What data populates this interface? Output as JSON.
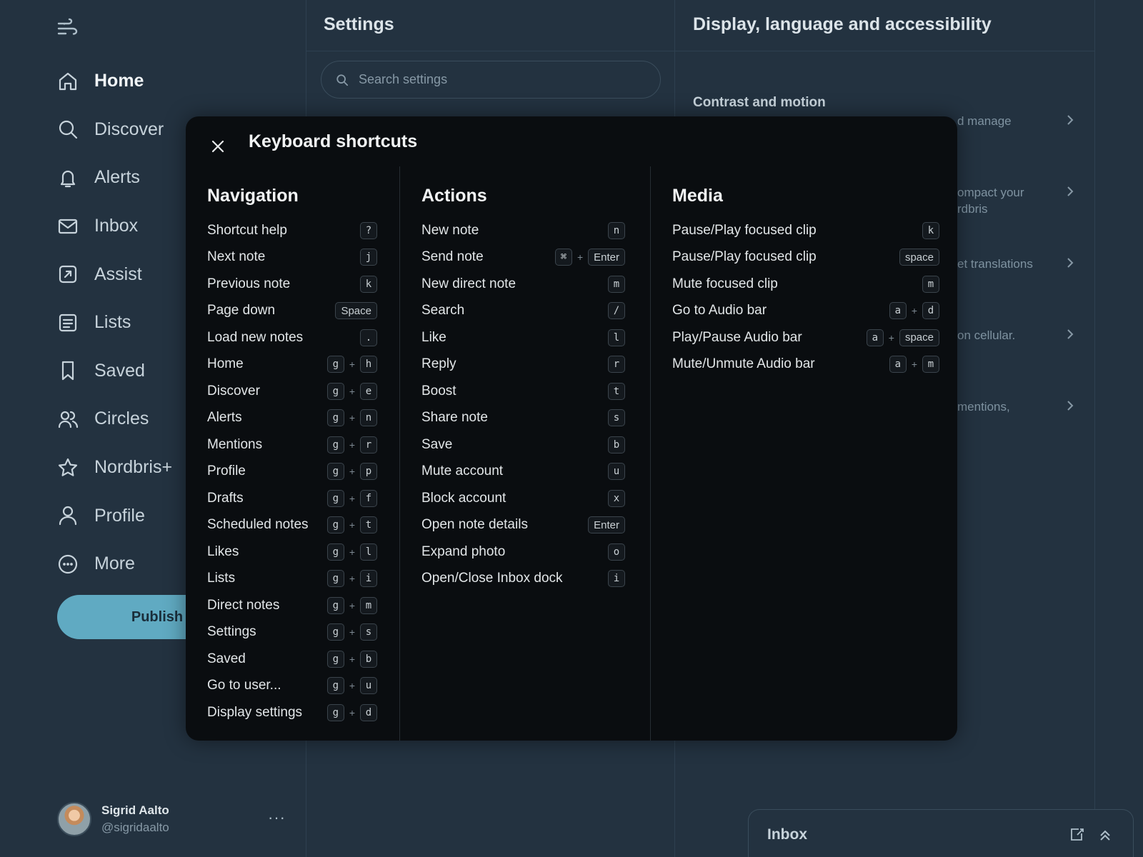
{
  "sidebar": {
    "nav": [
      {
        "label": "Home",
        "icon": "home-icon",
        "active": true
      },
      {
        "label": "Discover",
        "icon": "search-icon"
      },
      {
        "label": "Alerts",
        "icon": "bell-icon"
      },
      {
        "label": "Inbox",
        "icon": "mail-icon"
      },
      {
        "label": "Assist",
        "icon": "assist-icon"
      },
      {
        "label": "Lists",
        "icon": "list-icon"
      },
      {
        "label": "Saved",
        "icon": "bookmark-icon"
      },
      {
        "label": "Circles",
        "icon": "people-icon"
      },
      {
        "label": "Nordbris+",
        "icon": "star-icon"
      },
      {
        "label": "Profile",
        "icon": "user-icon"
      },
      {
        "label": "More",
        "icon": "more-circle-icon"
      }
    ],
    "publish_label": "Publish",
    "account": {
      "name": "Sigrid Aalto",
      "handle": "@sigridaalto",
      "more": "···"
    }
  },
  "settings": {
    "title": "Settings",
    "search_placeholder": "Search settings"
  },
  "display": {
    "title": "Display, language and accessibility",
    "section": "Contrast and motion",
    "snippets": [
      "d manage",
      "ompact your\nrdbris",
      "et translations",
      "on cellular.",
      "mentions,"
    ]
  },
  "inbox_dock": {
    "title": "Inbox"
  },
  "modal": {
    "title": "Keyboard shortcuts",
    "columns": [
      {
        "heading": "Navigation",
        "rows": [
          {
            "label": "Shortcut help",
            "keys": [
              "?"
            ]
          },
          {
            "label": "Next note",
            "keys": [
              "j"
            ]
          },
          {
            "label": "Previous note",
            "keys": [
              "k"
            ]
          },
          {
            "label": "Page down",
            "keys": [
              "Space"
            ]
          },
          {
            "label": "Load new notes",
            "keys": [
              "."
            ]
          },
          {
            "label": "Home",
            "keys": [
              "g",
              "h"
            ]
          },
          {
            "label": "Discover",
            "keys": [
              "g",
              "e"
            ]
          },
          {
            "label": "Alerts",
            "keys": [
              "g",
              "n"
            ]
          },
          {
            "label": "Mentions",
            "keys": [
              "g",
              "r"
            ]
          },
          {
            "label": "Profile",
            "keys": [
              "g",
              "p"
            ]
          },
          {
            "label": "Drafts",
            "keys": [
              "g",
              "f"
            ]
          },
          {
            "label": "Scheduled notes",
            "keys": [
              "g",
              "t"
            ]
          },
          {
            "label": "Likes",
            "keys": [
              "g",
              "l"
            ]
          },
          {
            "label": "Lists",
            "keys": [
              "g",
              "i"
            ]
          },
          {
            "label": "Direct notes",
            "keys": [
              "g",
              "m"
            ]
          },
          {
            "label": "Settings",
            "keys": [
              "g",
              "s"
            ]
          },
          {
            "label": "Saved",
            "keys": [
              "g",
              "b"
            ]
          },
          {
            "label": "Go to user...",
            "keys": [
              "g",
              "u"
            ]
          },
          {
            "label": "Display settings",
            "keys": [
              "g",
              "d"
            ]
          }
        ]
      },
      {
        "heading": "Actions",
        "rows": [
          {
            "label": "New note",
            "keys": [
              "n"
            ]
          },
          {
            "label": "Send note",
            "keys": [
              "⌘",
              "Enter"
            ]
          },
          {
            "label": "New direct note",
            "keys": [
              "m"
            ]
          },
          {
            "label": "Search",
            "keys": [
              "/"
            ]
          },
          {
            "label": "Like",
            "keys": [
              "l"
            ]
          },
          {
            "label": "Reply",
            "keys": [
              "r"
            ]
          },
          {
            "label": "Boost",
            "keys": [
              "t"
            ]
          },
          {
            "label": "Share note",
            "keys": [
              "s"
            ]
          },
          {
            "label": "Save",
            "keys": [
              "b"
            ]
          },
          {
            "label": "Mute account",
            "keys": [
              "u"
            ]
          },
          {
            "label": "Block account",
            "keys": [
              "x"
            ]
          },
          {
            "label": "Open note details",
            "keys": [
              "Enter"
            ]
          },
          {
            "label": "Expand photo",
            "keys": [
              "o"
            ]
          },
          {
            "label": "Open/Close Inbox dock",
            "keys": [
              "i"
            ]
          }
        ]
      },
      {
        "heading": "Media",
        "rows": [
          {
            "label": "Pause/Play focused clip",
            "keys": [
              "k"
            ]
          },
          {
            "label": "Pause/Play focused clip",
            "keys": [
              "space"
            ]
          },
          {
            "label": "Mute focused clip",
            "keys": [
              "m"
            ]
          },
          {
            "label": "Go to Audio bar",
            "keys": [
              "a",
              "d"
            ]
          },
          {
            "label": "Play/Pause Audio bar",
            "keys": [
              "a",
              "space"
            ]
          },
          {
            "label": "Mute/Unmute Audio bar",
            "keys": [
              "a",
              "m"
            ]
          }
        ]
      }
    ],
    "plus": "+"
  },
  "colors": {
    "accent": "#60aac2",
    "background": "#233240",
    "modal": "#0a0d10"
  }
}
